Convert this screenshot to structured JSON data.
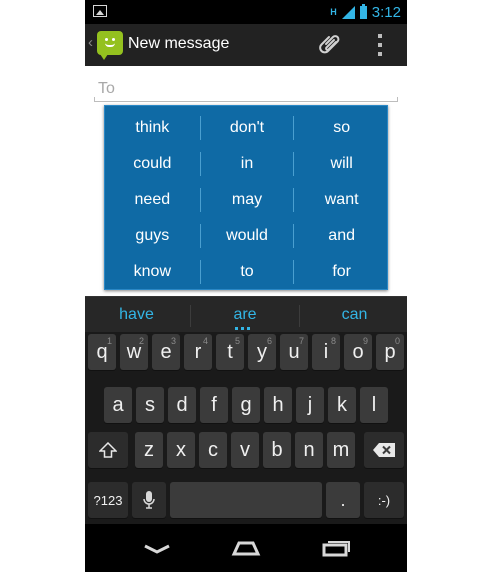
{
  "status_bar": {
    "network": "H",
    "time": "3:12"
  },
  "action_bar": {
    "title": "New message"
  },
  "compose": {
    "to_placeholder": "To"
  },
  "suggestion_popup": {
    "words": [
      "think",
      "don't",
      "so",
      "could",
      "in",
      "will",
      "need",
      "may",
      "want",
      "guys",
      "would",
      "and",
      "know",
      "to",
      "for"
    ]
  },
  "suggestion_strip": {
    "left": "have",
    "center": "are",
    "right": "can"
  },
  "keyboard": {
    "row1": [
      {
        "label": "q",
        "hint": "1"
      },
      {
        "label": "w",
        "hint": "2"
      },
      {
        "label": "e",
        "hint": "3"
      },
      {
        "label": "r",
        "hint": "4"
      },
      {
        "label": "t",
        "hint": "5"
      },
      {
        "label": "y",
        "hint": "6"
      },
      {
        "label": "u",
        "hint": "7"
      },
      {
        "label": "i",
        "hint": "8"
      },
      {
        "label": "o",
        "hint": "9"
      },
      {
        "label": "p",
        "hint": "0"
      }
    ],
    "row2": [
      "a",
      "s",
      "d",
      "f",
      "g",
      "h",
      "j",
      "k",
      "l"
    ],
    "row3": [
      "z",
      "x",
      "c",
      "v",
      "b",
      "n",
      "m"
    ],
    "symbols_label": "?123",
    "period_label": ".",
    "smiley_label": ":-)"
  },
  "colors": {
    "accent": "#33b5e5",
    "popup": "#0f6aa5",
    "app_icon": "#94c11f"
  },
  "icons": [
    "picture-icon",
    "signal-icon",
    "battery-icon",
    "messaging-app-icon",
    "paperclip-icon",
    "overflow-menu-icon",
    "shift-icon",
    "backspace-icon",
    "mic-icon",
    "back-icon",
    "home-icon",
    "recents-icon"
  ]
}
